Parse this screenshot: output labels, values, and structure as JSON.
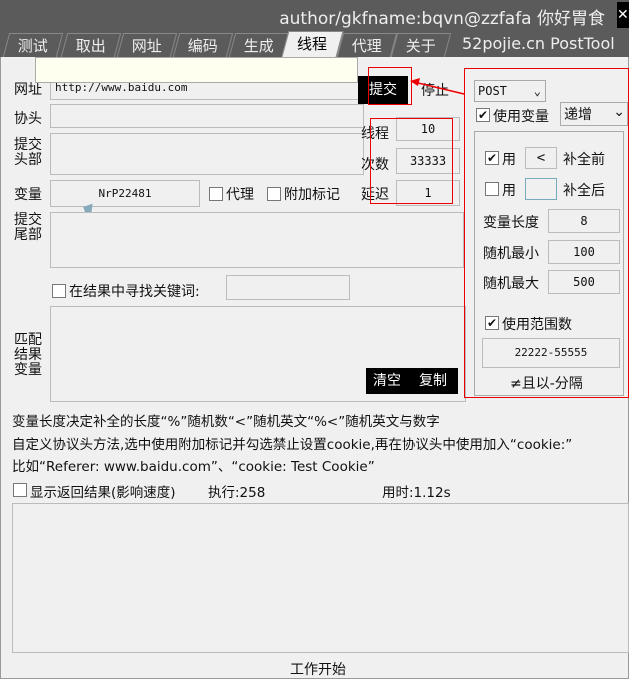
{
  "window": {
    "title": "author/gkfname:bqvn@zzfafa 你好胃食",
    "brand": "52pojie.cn  PostTool"
  },
  "tabs": [
    "测试",
    "取出",
    "网址",
    "编码",
    "生成",
    "线程",
    "代理",
    "关于"
  ],
  "form": {
    "url_label": "网址",
    "url_value": "http://www.baidu.com",
    "header_label": "协头",
    "submit_header_label": "提交\n头部",
    "var_label": "变量",
    "var_value": "NrP22481",
    "proxy_label": "代理",
    "extra_mark_label": "附加标记",
    "tail_label": "提交\n尾部",
    "search_keyword_label": "在结果中寻找关键词:",
    "match_label": "匹配\n结果\n变量",
    "clear": "清空",
    "copy": "复制",
    "submit": "提交",
    "stop": "停止",
    "thread_label": "线程",
    "thread_value": "10",
    "count_label": "次数",
    "count_value": "33333",
    "delay_label": "延迟",
    "delay_value": "1"
  },
  "right": {
    "method": "POST",
    "use_var": "使用变量",
    "mode": "递增",
    "use1": "用",
    "pad_front_char": "<",
    "pad_front": "补全前",
    "use2": "用",
    "pad_back_char": "",
    "pad_back": "补全后",
    "var_len_label": "变量长度",
    "var_len": "8",
    "rand_min_label": "随机最小",
    "rand_min": "100",
    "rand_max_label": "随机最大",
    "rand_max": "500",
    "use_range": "使用范围数",
    "range_value": "22222-55555",
    "range_hint": "≠且以-分隔"
  },
  "help": {
    "line1": "变量长度决定补全的长度“%”随机数“<”随机英文“%<”随机英文与数字",
    "line2": "自定义协议头方法,选中使用附加标记并勾选禁止设置cookie,再在协议头中使用加入“cookie:”",
    "line3": "比如“Referer: www.baidu.com”、“cookie: Test Cookie”"
  },
  "status": {
    "show_result": "显示返回结果(影响速度)",
    "exec": "执行:258",
    "time": "用时:1.12s"
  },
  "footer": {
    "start": "工作开始"
  }
}
